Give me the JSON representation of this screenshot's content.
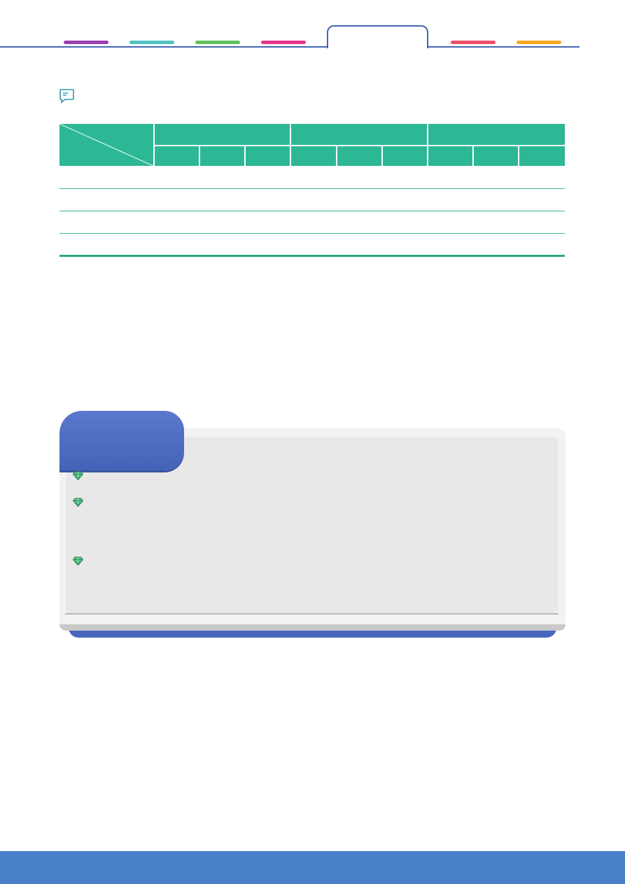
{
  "colors": {
    "rule_blue": "#4466b0",
    "tab_purple": "#9b3fb0",
    "tab_teal": "#4fc3c3",
    "tab_green": "#5fc05a",
    "tab_magenta": "#e6358b",
    "tab_red": "#ef4f67",
    "tab_orange": "#f7aa1f",
    "table_green": "#2db895",
    "summary_blue": "#4463b8",
    "footer_blue": "#4a7fc9"
  },
  "icons": {
    "note": "speech-bubble-icon",
    "bullet": "diamond-gem-icon"
  }
}
